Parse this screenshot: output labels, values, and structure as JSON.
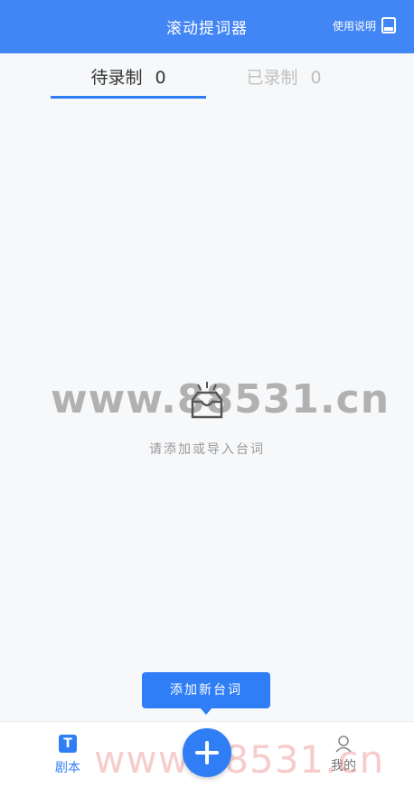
{
  "header": {
    "title": "滚动提词器",
    "help_label": "使用说明"
  },
  "tabs": [
    {
      "label": "待录制",
      "count": "0"
    },
    {
      "label": "已录制",
      "count": "0"
    }
  ],
  "empty_state": {
    "message": "请添加或导入台词"
  },
  "tooltip": {
    "label": "添加新台词"
  },
  "bottom_nav": {
    "left": {
      "icon_letter": "T",
      "label": "剧本"
    },
    "right": {
      "label": "我的"
    }
  },
  "watermark": "www.88531.cn",
  "colors": {
    "primary": "#4285f4",
    "accent": "#2f7ef6"
  }
}
